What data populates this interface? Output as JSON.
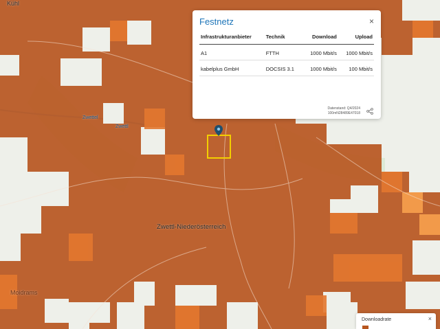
{
  "map": {
    "city_label": "Zwettl-Niederösterreich",
    "place_labels": [
      "Kühl",
      "Moidrams",
      "Zwettel",
      "Zwettl"
    ],
    "coverage_color": "#b7561f",
    "coverage_light": "#e3782f",
    "coverage_lighter": "#f29a4a",
    "selection_color": "#f3cf00"
  },
  "popup": {
    "title": "Festnetz",
    "close_symbol": "×",
    "columns": [
      "Infrastrukturanbieter",
      "Technik",
      "Download",
      "Upload"
    ],
    "rows": [
      [
        "A1",
        "FTTH",
        "1000 Mbit/s",
        "1000 Mbit/s"
      ],
      [
        "kabelplus GmbH",
        "DOCSIS 3.1",
        "1000 Mbit/s",
        "100 Mbit/s"
      ]
    ],
    "footer_line1": "Datenstand: Q4/2024",
    "footer_line2": "100mN28489E47018",
    "share_icon": "share-icon"
  },
  "legend": {
    "title": "Downloadrate",
    "close_symbol": "×"
  }
}
